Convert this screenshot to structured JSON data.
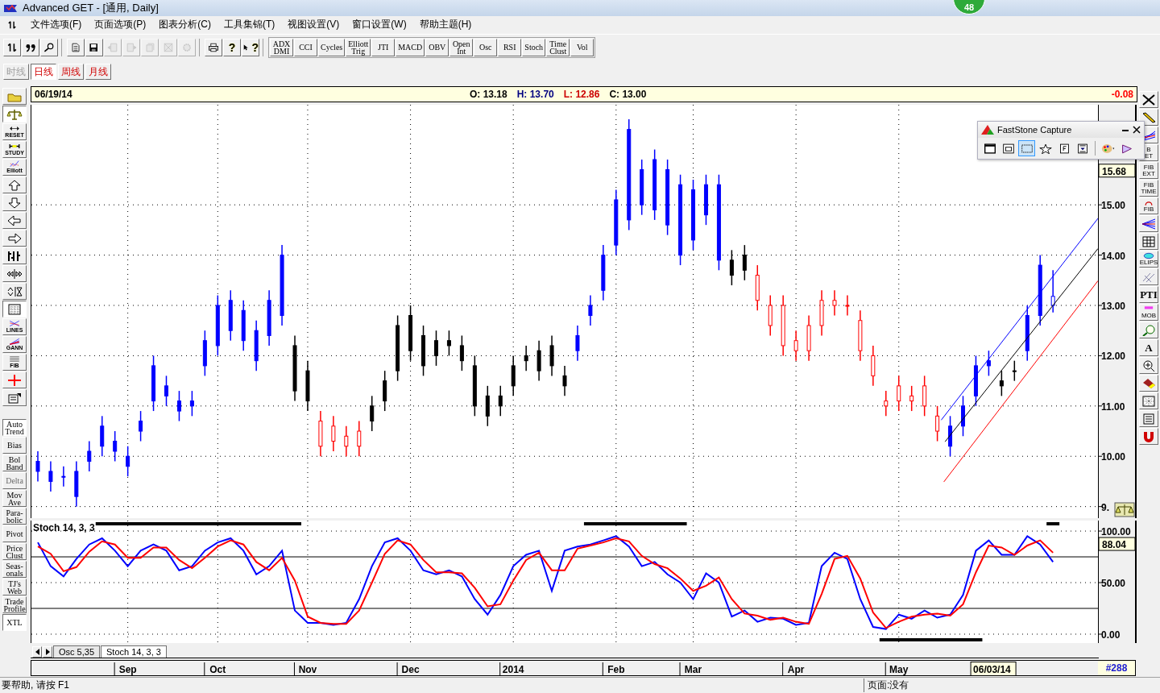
{
  "window": {
    "title": "Advanced GET - [通用, Daily]"
  },
  "badge": "48",
  "menu": [
    "文件选项(F)",
    "页面选项(P)",
    "图表分析(C)",
    "工具集锦(T)",
    "视图设置(V)",
    "窗口设置(W)",
    "帮助主题(H)"
  ],
  "tool_groups": [
    [
      {
        "kind": "icon",
        "disabled": false
      },
      {
        "kind": "icon",
        "disabled": false
      },
      {
        "kind": "icon",
        "disabled": false
      }
    ],
    [
      {
        "kind": "icon",
        "disabled": false
      },
      {
        "kind": "icon",
        "disabled": false
      },
      {
        "kind": "icon",
        "disabled": true
      },
      {
        "kind": "icon",
        "disabled": true
      },
      {
        "kind": "icon",
        "disabled": true
      },
      {
        "kind": "icon",
        "disabled": true
      },
      {
        "kind": "icon",
        "disabled": true
      }
    ],
    [
      {
        "kind": "icon",
        "disabled": false
      },
      {
        "kind": "text",
        "label": "?",
        "disabled": false
      },
      {
        "kind": "icon_text",
        "label": "?",
        "disabled": false
      }
    ]
  ],
  "study_buttons": [
    "ADX\nDMI",
    "CCI",
    "Cycles",
    "Elliott\nTrig",
    "JTI",
    "MACD",
    "OBV",
    "Open\nInt",
    "Osc",
    "RSI",
    "Stoch",
    "Time\nClust",
    "Vol"
  ],
  "timeframe_tabs": [
    {
      "label": "时线",
      "selected": false,
      "disabled": true
    },
    {
      "label": "日线",
      "selected": true,
      "disabled": false
    },
    {
      "label": "周线",
      "selected": false,
      "disabled": false
    },
    {
      "label": "月线",
      "selected": false,
      "disabled": false
    }
  ],
  "left_toolbar": [
    {
      "kind": "icon",
      "on": false,
      "disabled": false
    },
    {
      "kind": "icon",
      "on": true,
      "disabled": false
    },
    {
      "kind": "icon_text",
      "label": "RESET",
      "on": false,
      "disabled": false
    },
    {
      "kind": "icon_text",
      "label": "STUDY",
      "on": false,
      "disabled": false
    },
    {
      "kind": "icon_text",
      "label": "Elliott",
      "on": false,
      "disabled": false
    },
    {
      "kind": "icon",
      "on": false,
      "disabled": false
    },
    {
      "kind": "icon",
      "on": false,
      "disabled": false
    },
    {
      "kind": "icon",
      "on": false,
      "disabled": false
    },
    {
      "kind": "icon",
      "on": false,
      "disabled": false
    },
    {
      "kind": "icon",
      "on": false,
      "disabled": false
    },
    {
      "kind": "icon",
      "on": false,
      "disabled": false
    },
    {
      "kind": "icon",
      "on": false,
      "disabled": false
    },
    {
      "kind": "icon",
      "on": true,
      "disabled": false
    },
    {
      "kind": "icon_text",
      "label": "LINES",
      "on": false,
      "disabled": false
    },
    {
      "kind": "icon_text",
      "label": "GANN",
      "on": false,
      "disabled": false
    },
    {
      "kind": "icon_text",
      "label": "FIB",
      "on": false,
      "disabled": false
    },
    {
      "kind": "icon",
      "on": false,
      "disabled": false
    },
    {
      "kind": "icon",
      "on": false,
      "disabled": false
    },
    {
      "kind": "text",
      "label": "Auto\nTrend",
      "on": true,
      "disabled": false
    },
    {
      "kind": "text",
      "label": "Bias",
      "on": false,
      "disabled": false
    },
    {
      "kind": "text",
      "label": "Bol\nBand",
      "on": false,
      "disabled": false
    },
    {
      "kind": "text",
      "label": "Delta",
      "on": false,
      "disabled": true
    },
    {
      "kind": "text",
      "label": "Mov\nAve",
      "on": false,
      "disabled": false
    },
    {
      "kind": "text",
      "label": "Para-\nbolic",
      "on": false,
      "disabled": false
    },
    {
      "kind": "text",
      "label": "Pivot",
      "on": false,
      "disabled": false
    },
    {
      "kind": "text",
      "label": "Price\nClust",
      "on": false,
      "disabled": false
    },
    {
      "kind": "text",
      "label": "Seas-\nonals",
      "on": false,
      "disabled": false
    },
    {
      "kind": "text",
      "label": "TJ's\nWeb",
      "on": false,
      "disabled": false
    },
    {
      "kind": "text",
      "label": "Trade\nProfile",
      "on": false,
      "disabled": false
    },
    {
      "kind": "text",
      "label": "XTL",
      "on": true,
      "disabled": false
    }
  ],
  "right_toolbar": [
    {
      "kind": "icon"
    },
    {
      "kind": "icon"
    },
    {
      "kind": "icon"
    },
    {
      "kind": "text",
      "label": "B\nET"
    },
    {
      "kind": "text",
      "label": "FIB\nEXT"
    },
    {
      "kind": "text",
      "label": "FIB\nTIME"
    },
    {
      "kind": "icon_text",
      "label": "FIB"
    },
    {
      "kind": "icon"
    },
    {
      "kind": "icon"
    },
    {
      "kind": "icon_text",
      "label": "ELIPS"
    },
    {
      "kind": "icon"
    },
    {
      "kind": "text",
      "label": "PTI"
    },
    {
      "kind": "icon_text",
      "label": "MOB"
    },
    {
      "kind": "icon"
    },
    {
      "kind": "text",
      "label": "A"
    },
    {
      "kind": "icon"
    },
    {
      "kind": "icon"
    },
    {
      "kind": "icon"
    },
    {
      "kind": "icon"
    },
    {
      "kind": "icon"
    }
  ],
  "quote_header": {
    "date": "06/19/14",
    "values": [
      {
        "text": "O: 13.18",
        "color": "#000000"
      },
      {
        "text": "H: 13.70",
        "color": "#000080"
      },
      {
        "text": "L: 12.86",
        "color": "#cc0000"
      },
      {
        "text": "C: 13.00",
        "color": "#000000"
      }
    ],
    "change": "-0.08"
  },
  "price_chart": {
    "trend_lines": [
      {
        "color": "#0000ff"
      },
      {
        "color": "#000000"
      },
      {
        "color": "#ff0000"
      }
    ],
    "chart_data": {
      "type": "candlestick",
      "categories": [
        null,
        null,
        null,
        null,
        null,
        null,
        null,
        null,
        null,
        null,
        null,
        null,
        null,
        null,
        null,
        null,
        null,
        null,
        null,
        null,
        null,
        null,
        null,
        null,
        null,
        null,
        null,
        null,
        null,
        null,
        null,
        null,
        null,
        null,
        null,
        null,
        null,
        null,
        null,
        null,
        null,
        null,
        null,
        null,
        null,
        null,
        null,
        null,
        null,
        null,
        null,
        null,
        null,
        null,
        null,
        null,
        null,
        null,
        null,
        null,
        null,
        null,
        null,
        null,
        null,
        null,
        null,
        null,
        null,
        null,
        null,
        null,
        null,
        null,
        null,
        null,
        null,
        null,
        null,
        null,
        null,
        null,
        null
      ],
      "ylim": [
        8.77,
        16.99
      ],
      "grid": true,
      "yticks": [
        {
          "value": 9,
          "label": "9."
        },
        {
          "value": 10,
          "label": "10.00"
        },
        {
          "value": 11,
          "label": "11.00"
        },
        {
          "value": 12,
          "label": "12.00"
        },
        {
          "value": 13,
          "label": "13.00"
        },
        {
          "value": 14,
          "label": "14.00"
        },
        {
          "value": 15,
          "label": "15.00"
        }
      ],
      "series": [
        {
          "color": "#0000ff",
          "ohlc": [
            [
              9.7,
              10.1,
              9.5,
              9.9
            ],
            [
              9.5,
              9.9,
              9.3,
              9.7
            ],
            [
              9.6,
              9.8,
              9.4,
              9.6
            ],
            [
              9.2,
              9.9,
              9.0,
              9.7
            ],
            [
              9.9,
              10.3,
              9.7,
              10.1
            ],
            [
              10.2,
              10.8,
              10.0,
              10.6
            ],
            [
              10.1,
              10.5,
              9.9,
              10.3
            ],
            [
              9.8,
              10.2,
              9.6,
              10.0
            ],
            [
              10.5,
              10.9,
              10.3,
              10.7
            ],
            [
              11.1,
              12.0,
              10.9,
              11.8
            ],
            [
              11.2,
              11.6,
              11.0,
              11.4
            ],
            [
              10.9,
              11.3,
              10.7,
              11.1
            ],
            [
              11.0,
              11.3,
              10.8,
              11.1
            ],
            [
              11.8,
              12.5,
              11.6,
              12.3
            ],
            [
              12.2,
              13.2,
              12.0,
              13.0
            ],
            [
              12.5,
              13.3,
              12.3,
              13.1
            ],
            [
              12.3,
              13.1,
              12.1,
              12.9
            ],
            [
              11.9,
              12.7,
              11.7,
              12.5
            ],
            [
              12.4,
              13.3,
              12.2,
              13.1
            ],
            [
              12.8,
              14.2,
              12.6,
              14.0
            ],
            null,
            null,
            null,
            null,
            null,
            null,
            null,
            null,
            null,
            null,
            null,
            null,
            null,
            null,
            null,
            null,
            null,
            null,
            null,
            null,
            null,
            null,
            [
              12.1,
              12.6,
              11.9,
              12.4
            ],
            [
              12.8,
              13.2,
              12.6,
              13.0
            ],
            [
              13.3,
              14.2,
              13.1,
              14.0
            ],
            [
              14.2,
              15.3,
              14.0,
              15.1
            ],
            [
              14.7,
              16.7,
              14.5,
              16.5
            ],
            [
              15.0,
              15.9,
              14.8,
              15.7
            ],
            [
              14.9,
              16.1,
              14.7,
              15.9
            ],
            [
              14.6,
              15.9,
              14.4,
              15.7
            ],
            [
              14.0,
              15.6,
              13.8,
              15.4
            ],
            [
              14.3,
              15.5,
              14.1,
              15.3
            ],
            [
              14.8,
              15.6,
              14.6,
              15.4
            ],
            [
              13.9,
              15.6,
              13.7,
              15.4
            ],
            null,
            null,
            null,
            null,
            null,
            null,
            null,
            null,
            null,
            null,
            null,
            null,
            null,
            null,
            null,
            null,
            null,
            [
              10.2,
              10.8,
              10.0,
              10.6
            ],
            [
              10.6,
              11.2,
              10.4,
              11.0
            ],
            [
              11.2,
              12.0,
              11.0,
              11.8
            ],
            [
              11.8,
              12.1,
              11.6,
              11.9
            ],
            null,
            null,
            [
              12.1,
              13.0,
              11.9,
              12.8
            ],
            [
              12.8,
              14.0,
              12.6,
              13.8
            ],
            [
              13.18,
              13.7,
              12.86,
              13.0
            ],
            null,
            null,
            null
          ]
        },
        {
          "color": "#000000",
          "ohlc": [
            null,
            null,
            null,
            null,
            null,
            null,
            null,
            null,
            null,
            null,
            null,
            null,
            null,
            null,
            null,
            null,
            null,
            null,
            null,
            null,
            [
              11.3,
              12.4,
              11.1,
              12.2
            ],
            [
              11.1,
              11.9,
              10.9,
              11.7
            ],
            null,
            null,
            null,
            null,
            [
              10.7,
              11.2,
              10.5,
              11.0
            ],
            [
              11.1,
              11.7,
              10.9,
              11.5
            ],
            [
              11.7,
              12.8,
              11.5,
              12.6
            ],
            [
              12.1,
              13.0,
              11.9,
              12.8
            ],
            [
              11.8,
              12.6,
              11.6,
              12.4
            ],
            [
              12.0,
              12.5,
              11.8,
              12.3
            ],
            [
              12.2,
              12.5,
              12.0,
              12.3
            ],
            [
              11.9,
              12.4,
              11.7,
              12.2
            ],
            [
              11.0,
              12.0,
              10.8,
              11.8
            ],
            [
              10.8,
              11.4,
              10.6,
              11.2
            ],
            [
              11.0,
              11.4,
              10.8,
              11.2
            ],
            [
              11.4,
              12.0,
              11.2,
              11.8
            ],
            [
              11.9,
              12.2,
              11.7,
              12.0
            ],
            [
              11.7,
              12.3,
              11.5,
              12.1
            ],
            [
              11.8,
              12.4,
              11.6,
              12.2
            ],
            [
              11.4,
              11.8,
              11.2,
              11.6
            ],
            null,
            null,
            null,
            null,
            null,
            null,
            null,
            null,
            null,
            null,
            null,
            null,
            [
              13.6,
              14.1,
              13.4,
              13.9
            ],
            [
              13.7,
              14.2,
              13.5,
              14.0
            ],
            null,
            null,
            null,
            null,
            null,
            null,
            null,
            null,
            null,
            null,
            null,
            null,
            null,
            null,
            null,
            null,
            null,
            null,
            null,
            [
              11.4,
              11.7,
              11.2,
              11.5
            ],
            [
              11.7,
              11.9,
              11.5,
              11.7
            ],
            null,
            null,
            null,
            null,
            null,
            null
          ]
        },
        {
          "color": "#ff0000",
          "ohlc": [
            null,
            null,
            null,
            null,
            null,
            null,
            null,
            null,
            null,
            null,
            null,
            null,
            null,
            null,
            null,
            null,
            null,
            null,
            null,
            null,
            null,
            null,
            [
              10.7,
              10.9,
              10.0,
              10.2
            ],
            [
              10.6,
              10.8,
              10.1,
              10.3
            ],
            [
              10.4,
              10.6,
              10.0,
              10.2
            ],
            [
              10.5,
              10.7,
              10.0,
              10.2
            ],
            null,
            null,
            null,
            null,
            null,
            null,
            null,
            null,
            null,
            null,
            null,
            null,
            null,
            null,
            null,
            null,
            null,
            null,
            null,
            null,
            null,
            null,
            null,
            null,
            null,
            null,
            null,
            null,
            null,
            null,
            [
              13.6,
              13.8,
              12.9,
              13.1
            ],
            [
              13.0,
              13.2,
              12.4,
              12.6
            ],
            [
              13.0,
              13.2,
              12.0,
              12.2
            ],
            [
              12.3,
              12.5,
              11.9,
              12.1
            ],
            [
              12.6,
              12.8,
              11.9,
              12.1
            ],
            [
              13.1,
              13.3,
              12.4,
              12.6
            ],
            [
              13.1,
              13.3,
              12.8,
              13.0
            ],
            [
              13.0,
              13.2,
              12.8,
              13.0
            ],
            [
              12.7,
              12.9,
              11.9,
              12.1
            ],
            [
              12.0,
              12.2,
              11.4,
              11.6
            ],
            [
              11.1,
              11.3,
              10.8,
              11.0
            ],
            [
              11.4,
              11.6,
              10.9,
              11.1
            ],
            [
              11.2,
              11.4,
              10.9,
              11.1
            ],
            [
              11.4,
              11.6,
              10.8,
              11.0
            ],
            [
              10.8,
              11.0,
              10.3,
              10.5
            ],
            null,
            null,
            null,
            null,
            null,
            null,
            null,
            null,
            null,
            null,
            null,
            null
          ]
        }
      ],
      "annotations": [
        "15.68"
      ]
    }
  },
  "stoch_chart": {
    "chart_data": {
      "type": "line",
      "title": "Stoch 14, 3, 3",
      "categories": [
        null,
        null,
        null,
        null,
        null,
        null,
        null,
        "Sep",
        null,
        null,
        null,
        null,
        null,
        null,
        "Oct",
        null,
        null,
        null,
        null,
        null,
        null,
        "Nov",
        null,
        null,
        null,
        null,
        null,
        null,
        null,
        "Dec",
        null,
        null,
        null,
        null,
        null,
        null,
        null,
        "2014",
        null,
        null,
        null,
        null,
        null,
        null,
        null,
        "Feb",
        null,
        null,
        null,
        null,
        null,
        "Mar",
        null,
        null,
        null,
        null,
        null,
        null,
        null,
        "Apr",
        null,
        null,
        null,
        null,
        null,
        null,
        null,
        "May",
        null,
        null,
        null,
        null,
        null,
        null,
        null,
        null,
        null,
        null,
        null,
        null,
        null,
        null,
        null
      ],
      "ylim": [
        -8.6,
        110.2
      ],
      "grid": true,
      "yticks": [
        {
          "value": 0,
          "label": "0.00"
        },
        {
          "value": 50,
          "label": "50.00"
        },
        {
          "value": 100,
          "label": "100.00"
        }
      ],
      "series": [
        {
          "color": "#0000ff",
          "values": [
            89,
            66,
            56,
            73,
            87,
            93,
            81,
            66,
            81,
            87,
            81,
            62,
            66,
            81,
            89,
            93,
            81,
            58,
            66,
            81,
            23,
            11,
            11,
            9,
            11,
            34,
            66,
            89,
            93,
            81,
            62,
            58,
            62,
            56,
            34,
            19,
            38,
            66,
            77,
            81,
            42,
            81,
            85,
            87,
            91,
            95,
            85,
            66,
            70,
            58,
            50,
            34,
            59,
            50,
            17,
            23,
            12,
            16,
            15,
            9,
            11,
            66,
            79,
            73,
            34,
            7,
            5,
            19,
            15,
            23,
            16,
            19,
            38,
            81,
            91,
            77,
            77,
            95,
            87,
            70,
            null,
            null,
            null
          ]
        },
        {
          "color": "#ff0000",
          "values": [
            85,
            78,
            61,
            65,
            80,
            90,
            87,
            74,
            74,
            84,
            84,
            72,
            64,
            74,
            85,
            91,
            87,
            70,
            62,
            74,
            52,
            17,
            11,
            10,
            10,
            23,
            50,
            78,
            91,
            87,
            72,
            60,
            60,
            59,
            45,
            27,
            29,
            52,
            72,
            79,
            62,
            62,
            83,
            86,
            89,
            93,
            90,
            76,
            68,
            64,
            54,
            42,
            47,
            55,
            34,
            20,
            18,
            14,
            16,
            12,
            10,
            39,
            73,
            76,
            54,
            21,
            6,
            12,
            17,
            19,
            20,
            18,
            29,
            60,
            86,
            84,
            77,
            86,
            91,
            79,
            null,
            null,
            null
          ]
        }
      ],
      "ref_lines": [
        {
          "axis": "y",
          "value": 75
        },
        {
          "axis": "y",
          "value": 25
        }
      ],
      "annotations": [
        "88.04"
      ]
    }
  },
  "indicator_tabs": [
    {
      "label": "Osc 5,35",
      "selected": false
    },
    {
      "label": "Stoch 14, 3, 3",
      "selected": true
    }
  ],
  "time_axis": {
    "cursor_date": "06/03/14",
    "record": "#288"
  },
  "faststone": {
    "title": "FastStone Capture",
    "tools": [
      {
        "selected": false
      },
      {
        "selected": false
      },
      {
        "selected": true
      },
      {
        "selected": false
      },
      {
        "selected": false
      },
      {
        "selected": false
      },
      {
        "selected": false
      },
      {
        "selected": false
      }
    ]
  },
  "status_bar": {
    "help": "要帮助, 请按 F1",
    "page": "页面:没有"
  }
}
